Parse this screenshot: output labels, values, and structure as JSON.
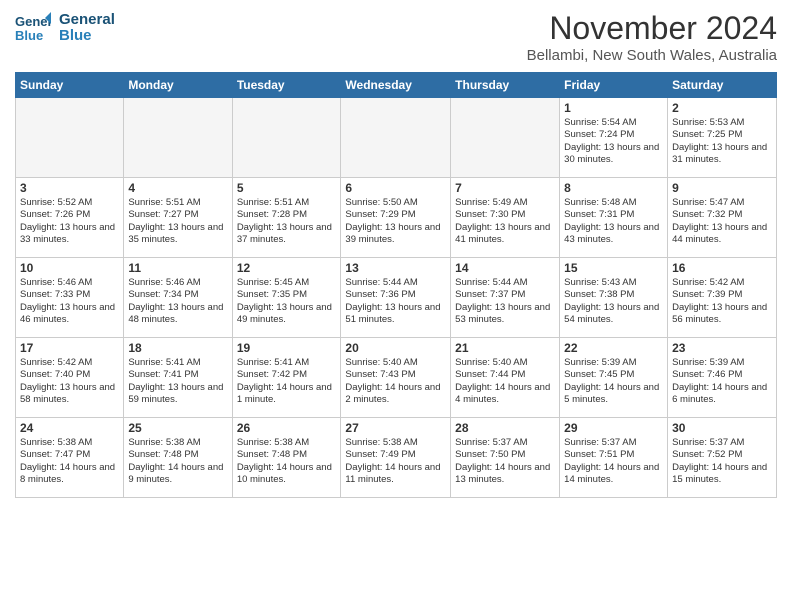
{
  "header": {
    "logo_line1": "General",
    "logo_line2": "Blue",
    "month": "November 2024",
    "location": "Bellambi, New South Wales, Australia"
  },
  "weekdays": [
    "Sunday",
    "Monday",
    "Tuesday",
    "Wednesday",
    "Thursday",
    "Friday",
    "Saturday"
  ],
  "weeks": [
    [
      {
        "day": "",
        "info": "",
        "empty": true
      },
      {
        "day": "",
        "info": "",
        "empty": true
      },
      {
        "day": "",
        "info": "",
        "empty": true
      },
      {
        "day": "",
        "info": "",
        "empty": true
      },
      {
        "day": "",
        "info": "",
        "empty": true
      },
      {
        "day": "1",
        "info": "Sunrise: 5:54 AM\nSunset: 7:24 PM\nDaylight: 13 hours\nand 30 minutes."
      },
      {
        "day": "2",
        "info": "Sunrise: 5:53 AM\nSunset: 7:25 PM\nDaylight: 13 hours\nand 31 minutes."
      }
    ],
    [
      {
        "day": "3",
        "info": "Sunrise: 5:52 AM\nSunset: 7:26 PM\nDaylight: 13 hours\nand 33 minutes."
      },
      {
        "day": "4",
        "info": "Sunrise: 5:51 AM\nSunset: 7:27 PM\nDaylight: 13 hours\nand 35 minutes."
      },
      {
        "day": "5",
        "info": "Sunrise: 5:51 AM\nSunset: 7:28 PM\nDaylight: 13 hours\nand 37 minutes."
      },
      {
        "day": "6",
        "info": "Sunrise: 5:50 AM\nSunset: 7:29 PM\nDaylight: 13 hours\nand 39 minutes."
      },
      {
        "day": "7",
        "info": "Sunrise: 5:49 AM\nSunset: 7:30 PM\nDaylight: 13 hours\nand 41 minutes."
      },
      {
        "day": "8",
        "info": "Sunrise: 5:48 AM\nSunset: 7:31 PM\nDaylight: 13 hours\nand 43 minutes."
      },
      {
        "day": "9",
        "info": "Sunrise: 5:47 AM\nSunset: 7:32 PM\nDaylight: 13 hours\nand 44 minutes."
      }
    ],
    [
      {
        "day": "10",
        "info": "Sunrise: 5:46 AM\nSunset: 7:33 PM\nDaylight: 13 hours\nand 46 minutes."
      },
      {
        "day": "11",
        "info": "Sunrise: 5:46 AM\nSunset: 7:34 PM\nDaylight: 13 hours\nand 48 minutes."
      },
      {
        "day": "12",
        "info": "Sunrise: 5:45 AM\nSunset: 7:35 PM\nDaylight: 13 hours\nand 49 minutes."
      },
      {
        "day": "13",
        "info": "Sunrise: 5:44 AM\nSunset: 7:36 PM\nDaylight: 13 hours\nand 51 minutes."
      },
      {
        "day": "14",
        "info": "Sunrise: 5:44 AM\nSunset: 7:37 PM\nDaylight: 13 hours\nand 53 minutes."
      },
      {
        "day": "15",
        "info": "Sunrise: 5:43 AM\nSunset: 7:38 PM\nDaylight: 13 hours\nand 54 minutes."
      },
      {
        "day": "16",
        "info": "Sunrise: 5:42 AM\nSunset: 7:39 PM\nDaylight: 13 hours\nand 56 minutes."
      }
    ],
    [
      {
        "day": "17",
        "info": "Sunrise: 5:42 AM\nSunset: 7:40 PM\nDaylight: 13 hours\nand 58 minutes."
      },
      {
        "day": "18",
        "info": "Sunrise: 5:41 AM\nSunset: 7:41 PM\nDaylight: 13 hours\nand 59 minutes."
      },
      {
        "day": "19",
        "info": "Sunrise: 5:41 AM\nSunset: 7:42 PM\nDaylight: 14 hours\nand 1 minute."
      },
      {
        "day": "20",
        "info": "Sunrise: 5:40 AM\nSunset: 7:43 PM\nDaylight: 14 hours\nand 2 minutes."
      },
      {
        "day": "21",
        "info": "Sunrise: 5:40 AM\nSunset: 7:44 PM\nDaylight: 14 hours\nand 4 minutes."
      },
      {
        "day": "22",
        "info": "Sunrise: 5:39 AM\nSunset: 7:45 PM\nDaylight: 14 hours\nand 5 minutes."
      },
      {
        "day": "23",
        "info": "Sunrise: 5:39 AM\nSunset: 7:46 PM\nDaylight: 14 hours\nand 6 minutes."
      }
    ],
    [
      {
        "day": "24",
        "info": "Sunrise: 5:38 AM\nSunset: 7:47 PM\nDaylight: 14 hours\nand 8 minutes."
      },
      {
        "day": "25",
        "info": "Sunrise: 5:38 AM\nSunset: 7:48 PM\nDaylight: 14 hours\nand 9 minutes."
      },
      {
        "day": "26",
        "info": "Sunrise: 5:38 AM\nSunset: 7:48 PM\nDaylight: 14 hours\nand 10 minutes."
      },
      {
        "day": "27",
        "info": "Sunrise: 5:38 AM\nSunset: 7:49 PM\nDaylight: 14 hours\nand 11 minutes."
      },
      {
        "day": "28",
        "info": "Sunrise: 5:37 AM\nSunset: 7:50 PM\nDaylight: 14 hours\nand 13 minutes."
      },
      {
        "day": "29",
        "info": "Sunrise: 5:37 AM\nSunset: 7:51 PM\nDaylight: 14 hours\nand 14 minutes."
      },
      {
        "day": "30",
        "info": "Sunrise: 5:37 AM\nSunset: 7:52 PM\nDaylight: 14 hours\nand 15 minutes."
      }
    ]
  ]
}
